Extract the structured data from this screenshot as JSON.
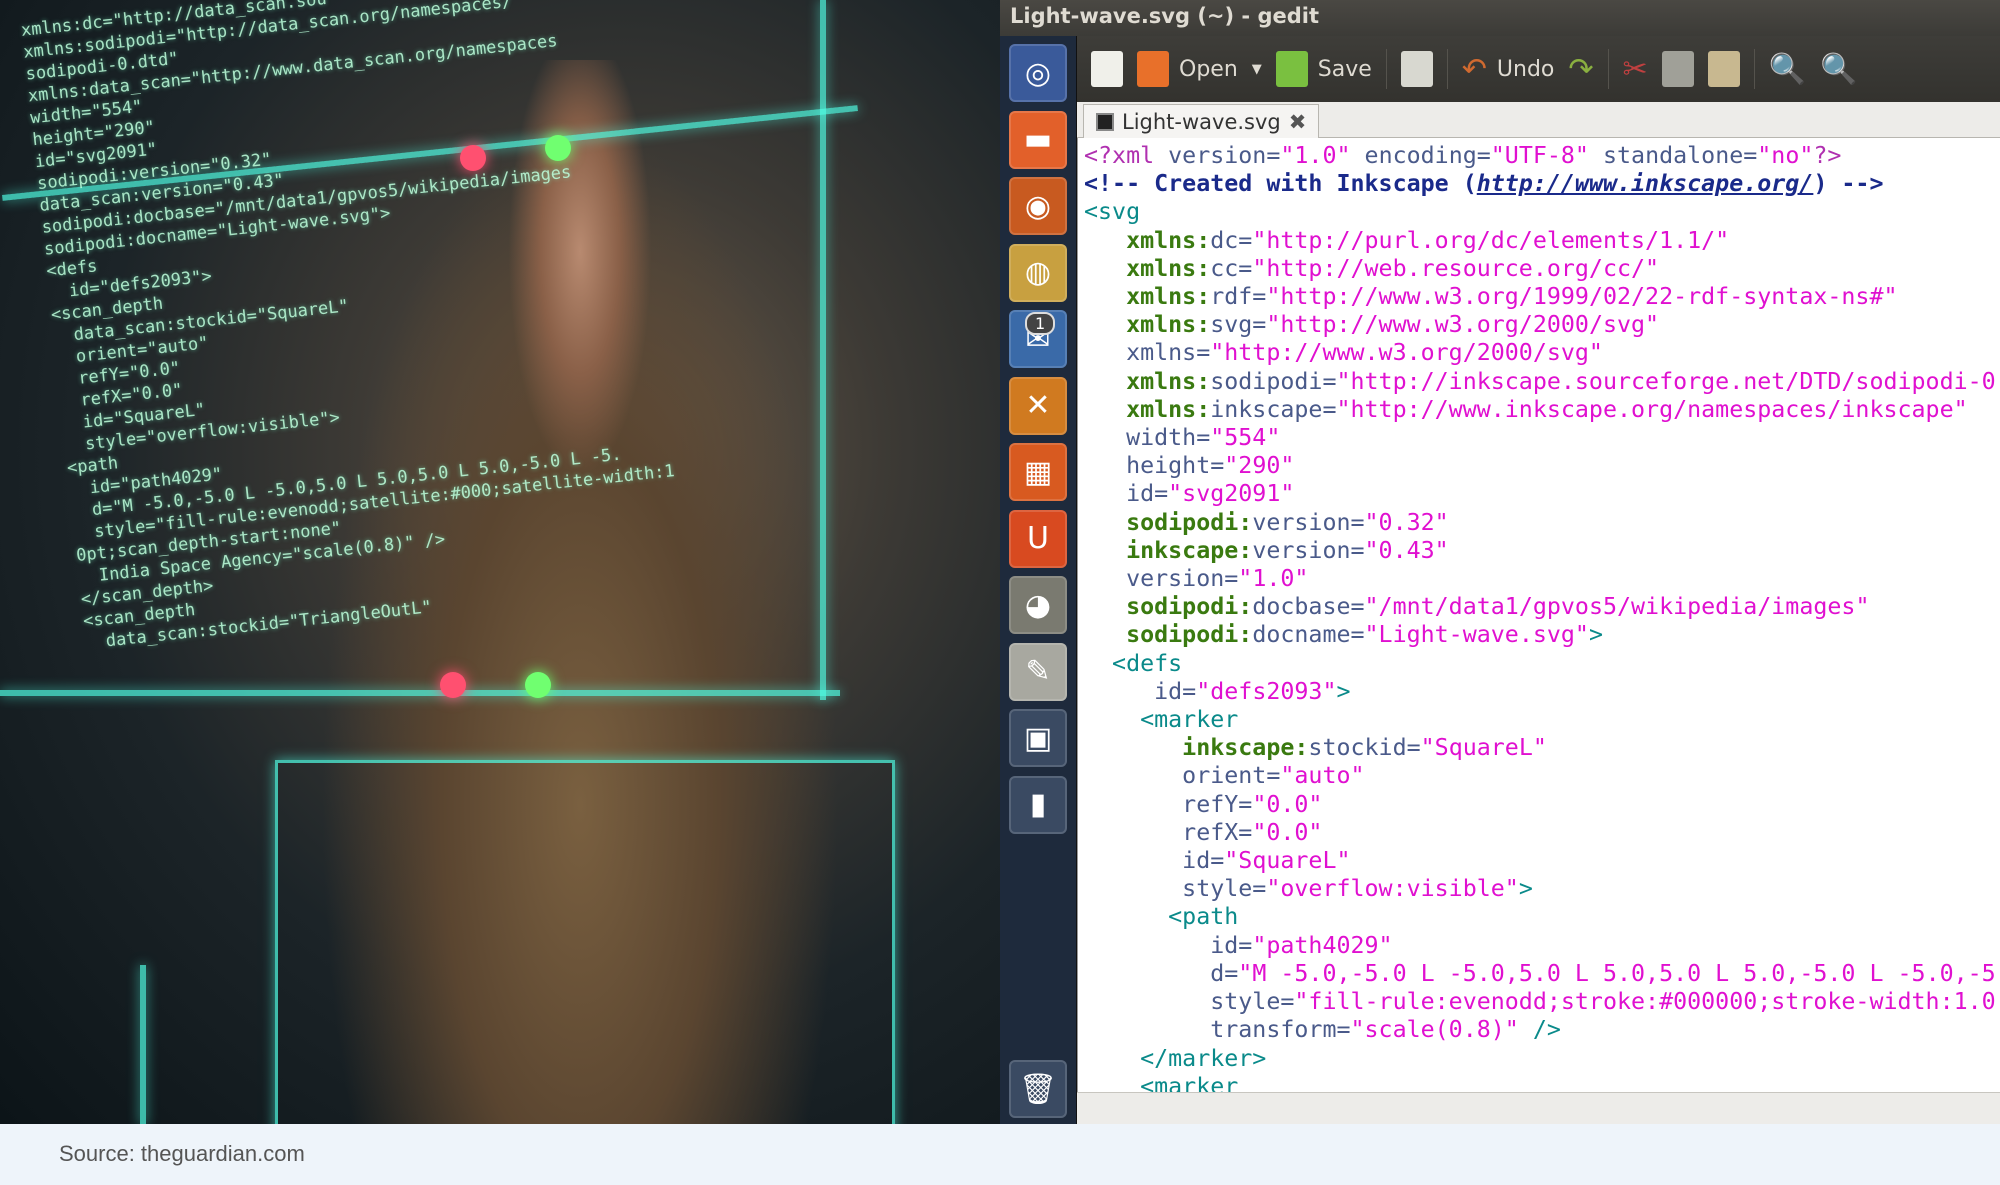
{
  "photo": {
    "overlay_text": [
      "xmlns:dc=\"http://data_scan.sou",
      "xmlns:sodipodi=\"http://data_scan.org/namespaces/",
      "sodipodi-0.dtd\"",
      "xmlns:data_scan=\"http://www.data_scan.org/namespaces",
      "width=\"554\"",
      "height=\"290\"",
      "id=\"svg2091\"",
      "sodipodi:version=\"0.32\"",
      "data_scan:version=\"0.43\"",
      "sodipodi:docbase=\"/mnt/data1/gpvos5/wikipedia/images",
      "sodipodi:docname=\"Light-wave.svg\">",
      "<defs",
      "  id=\"defs2093\">",
      "<scan_depth",
      "  data_scan:stockid=\"SquareL\"",
      "  orient=\"auto\"",
      "  refY=\"0.0\"",
      "  refX=\"0.0\"",
      "  id=\"SquareL\"",
      "  style=\"overflow:visible\">",
      "<path",
      "  id=\"path4029\"",
      "  d=\"M -5.0,-5.0 L -5.0,5.0 L 5.0,5.0 L 5.0,-5.0 L -5.",
      "  style=\"fill-rule:evenodd;satellite:#000;satellite-width:1",
      "0pt;scan_depth-start:none\"",
      "  India Space Agency=\"scale(0.8)\" />",
      "</scan_depth>",
      "<scan_depth",
      "  data_scan:stockid=\"TriangleOutL\""
    ]
  },
  "window": {
    "title": "Light-wave.svg (~) - gedit"
  },
  "launcher": {
    "items": [
      {
        "name": "dash-home",
        "glyph": "◎",
        "color": "#3a5a9a"
      },
      {
        "name": "files",
        "glyph": "▬",
        "color": "#e2602a"
      },
      {
        "name": "firefox",
        "glyph": "◉",
        "color": "#c85a20"
      },
      {
        "name": "chrome",
        "glyph": "◍",
        "color": "#c8a040"
      },
      {
        "name": "thunderbird",
        "glyph": "✉",
        "color": "#3a6aa8",
        "badge": "1"
      },
      {
        "name": "xchat",
        "glyph": "✕",
        "color": "#d07a20"
      },
      {
        "name": "software-center",
        "glyph": "▦",
        "color": "#d85a20"
      },
      {
        "name": "ubuntu-one",
        "glyph": "U",
        "color": "#d84a20"
      },
      {
        "name": "gimp",
        "glyph": "◕",
        "color": "#7a7a70"
      },
      {
        "name": "text-editor",
        "glyph": "✎",
        "color": "#a8a8a0"
      },
      {
        "name": "workspace-switcher",
        "glyph": "▣",
        "color": "#3a4a62"
      },
      {
        "name": "usb-drive",
        "glyph": "▮",
        "color": "#3a4a62"
      }
    ],
    "trash": {
      "name": "trash",
      "glyph": "🗑",
      "color": "#3a4a62"
    }
  },
  "toolbar": {
    "open_label": "Open",
    "save_label": "Save",
    "undo_label": "Undo"
  },
  "tab": {
    "label": "Light-wave.svg",
    "close": "✖"
  },
  "code": [
    [
      [
        "<?xml ",
        "c-pi"
      ],
      [
        "version=",
        "c-at"
      ],
      [
        "\"1.0\"",
        "c-str"
      ],
      [
        " encoding=",
        "c-at"
      ],
      [
        "\"UTF-8\"",
        "c-str"
      ],
      [
        " standalone=",
        "c-at"
      ],
      [
        "\"no\"",
        "c-str"
      ],
      [
        "?>",
        "c-pi"
      ]
    ],
    [
      [
        "<!-- Created with Inkscape (",
        "c-cm"
      ],
      [
        "http://www.inkscape.org/",
        "c-link"
      ],
      [
        ") -->",
        "c-cm"
      ]
    ],
    [
      [
        "<svg",
        "c-tag"
      ]
    ],
    [
      [
        "   xmlns:",
        "c-ns"
      ],
      [
        "dc=",
        "c-at"
      ],
      [
        "\"http://purl.org/dc/elements/1.1/\"",
        "c-str"
      ]
    ],
    [
      [
        "   xmlns:",
        "c-ns"
      ],
      [
        "cc=",
        "c-at"
      ],
      [
        "\"http://web.resource.org/cc/\"",
        "c-str"
      ]
    ],
    [
      [
        "   xmlns:",
        "c-ns"
      ],
      [
        "rdf=",
        "c-at"
      ],
      [
        "\"http://www.w3.org/1999/02/22-rdf-syntax-ns#\"",
        "c-str"
      ]
    ],
    [
      [
        "   xmlns:",
        "c-ns"
      ],
      [
        "svg=",
        "c-at"
      ],
      [
        "\"http://www.w3.org/2000/svg\"",
        "c-str"
      ]
    ],
    [
      [
        "   xmlns=",
        "c-at"
      ],
      [
        "\"http://www.w3.org/2000/svg\"",
        "c-str"
      ]
    ],
    [
      [
        "   xmlns:",
        "c-ns"
      ],
      [
        "sodipodi=",
        "c-at"
      ],
      [
        "\"http://inkscape.sourceforge.net/DTD/sodipodi-0",
        "c-str"
      ]
    ],
    [
      [
        "   xmlns:",
        "c-ns"
      ],
      [
        "inkscape=",
        "c-at"
      ],
      [
        "\"http://www.inkscape.org/namespaces/inkscape\"",
        "c-str"
      ]
    ],
    [
      [
        "   width=",
        "c-at"
      ],
      [
        "\"554\"",
        "c-str"
      ]
    ],
    [
      [
        "   height=",
        "c-at"
      ],
      [
        "\"290\"",
        "c-str"
      ]
    ],
    [
      [
        "   id=",
        "c-at"
      ],
      [
        "\"svg2091\"",
        "c-str"
      ]
    ],
    [
      [
        "   sodipodi:",
        "c-ns"
      ],
      [
        "version=",
        "c-at"
      ],
      [
        "\"0.32\"",
        "c-str"
      ]
    ],
    [
      [
        "   inkscape:",
        "c-ns"
      ],
      [
        "version=",
        "c-at"
      ],
      [
        "\"0.43\"",
        "c-str"
      ]
    ],
    [
      [
        "   version=",
        "c-at"
      ],
      [
        "\"1.0\"",
        "c-str"
      ]
    ],
    [
      [
        "   sodipodi:",
        "c-ns"
      ],
      [
        "docbase=",
        "c-at"
      ],
      [
        "\"/mnt/data1/gpvos5/wikipedia/images\"",
        "c-str"
      ]
    ],
    [
      [
        "   sodipodi:",
        "c-ns"
      ],
      [
        "docname=",
        "c-at"
      ],
      [
        "\"Light-wave.svg\"",
        "c-str"
      ],
      [
        ">",
        "c-tag"
      ]
    ],
    [
      [
        "  <defs",
        "c-tag"
      ]
    ],
    [
      [
        "     id=",
        "c-at"
      ],
      [
        "\"defs2093\"",
        "c-str"
      ],
      [
        ">",
        "c-tag"
      ]
    ],
    [
      [
        "    <marker",
        "c-tag"
      ]
    ],
    [
      [
        "       inkscape:",
        "c-ns"
      ],
      [
        "stockid=",
        "c-at"
      ],
      [
        "\"SquareL\"",
        "c-str"
      ]
    ],
    [
      [
        "       orient=",
        "c-at"
      ],
      [
        "\"auto\"",
        "c-str"
      ]
    ],
    [
      [
        "       refY=",
        "c-at"
      ],
      [
        "\"0.0\"",
        "c-str"
      ]
    ],
    [
      [
        "       refX=",
        "c-at"
      ],
      [
        "\"0.0\"",
        "c-str"
      ]
    ],
    [
      [
        "       id=",
        "c-at"
      ],
      [
        "\"SquareL\"",
        "c-str"
      ]
    ],
    [
      [
        "       style=",
        "c-at"
      ],
      [
        "\"overflow:visible\"",
        "c-str"
      ],
      [
        ">",
        "c-tag"
      ]
    ],
    [
      [
        "      <path",
        "c-tag"
      ]
    ],
    [
      [
        "         id=",
        "c-at"
      ],
      [
        "\"path4029\"",
        "c-str"
      ]
    ],
    [
      [
        "         d=",
        "c-at"
      ],
      [
        "\"M -5.0,-5.0 L -5.0,5.0 L 5.0,5.0 L 5.0,-5.0 L -5.0,-5",
        "c-str"
      ]
    ],
    [
      [
        "         style=",
        "c-at"
      ],
      [
        "\"fill-rule:evenodd;stroke:#000000;stroke-width:1.0",
        "c-str"
      ]
    ],
    [
      [
        "         transform=",
        "c-at"
      ],
      [
        "\"scale(0.8)\"",
        "c-str"
      ],
      [
        " />",
        "c-tag"
      ]
    ],
    [
      [
        "    </marker>",
        "c-tag"
      ]
    ],
    [
      [
        "    <marker",
        "c-tag"
      ]
    ]
  ],
  "footer": {
    "source": "Source: theguardian.com"
  }
}
